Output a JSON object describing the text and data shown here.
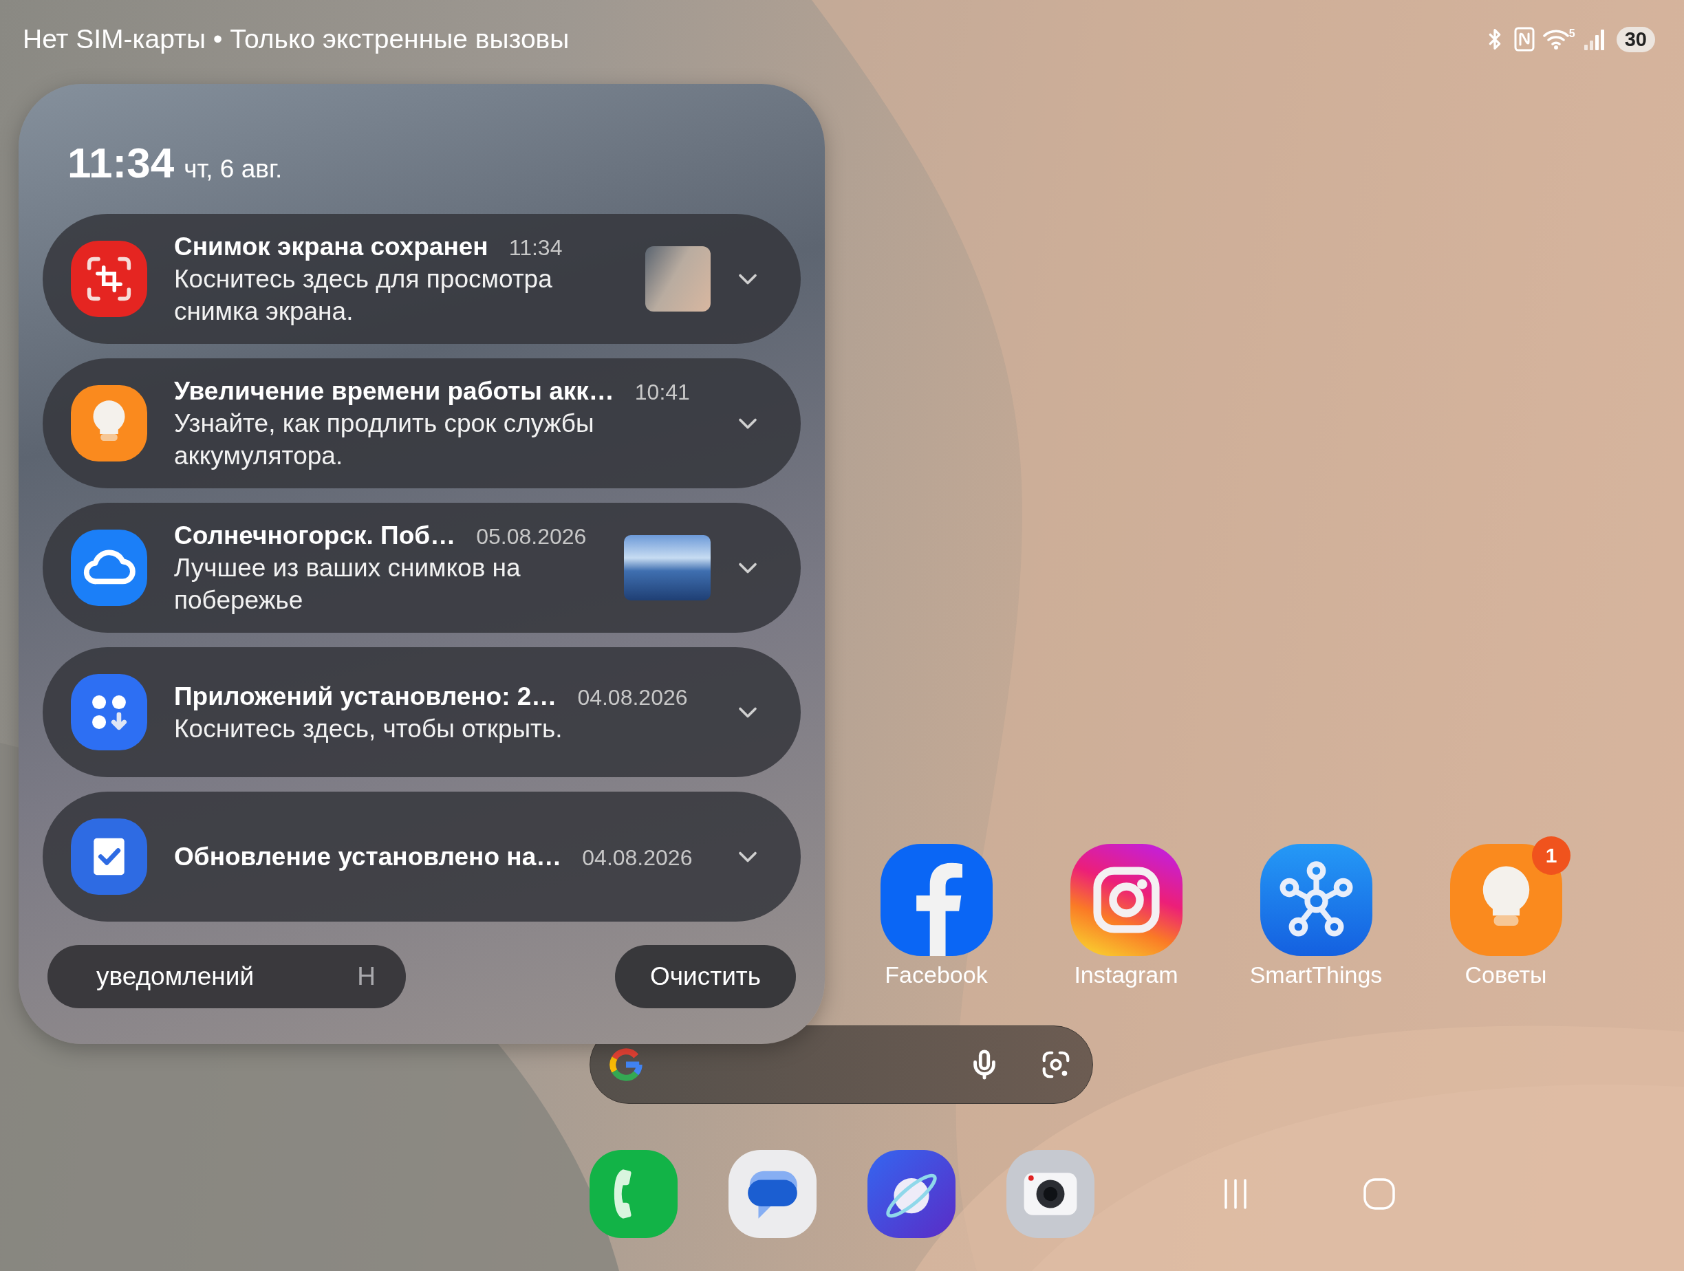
{
  "status_bar": {
    "message": "Нет SIM-карты • Только экстренные вызовы",
    "wifi_band": "5",
    "battery": "30"
  },
  "notification_panel": {
    "time": "11:34",
    "date": "чт, 6 авг.",
    "notifications": [
      {
        "kind": "screenshot",
        "title": "Снимок экрана сохранен",
        "time": "11:34",
        "body": "Коснитесь здесь для просмотра снимка экрана.",
        "thumbnail": true,
        "expanded": false
      },
      {
        "kind": "tips",
        "title": "Увеличение времени работы акк…",
        "time": "10:41",
        "body": "Узнайте, как продлить срок службы аккумулятора.",
        "thumbnail": false,
        "expanded": false
      },
      {
        "kind": "cloud",
        "title": "Солнечногорск. Поб…",
        "time": "05.08.2026",
        "body": "Лучшее из ваших снимков на побережье",
        "thumbnail": true,
        "expanded": false
      },
      {
        "kind": "apps",
        "title": "Приложений установлено: 2…",
        "time": "04.08.2026",
        "body": "Коснитесь здесь, чтобы открыть.",
        "thumbnail": false,
        "expanded": false
      },
      {
        "kind": "update",
        "title": "Обновление установлено на…",
        "time": "04.08.2026",
        "thumbnail": false,
        "expanded": false
      }
    ],
    "settings_button": [
      "уведомлений",
      "Н"
    ],
    "clear_button": "Очистить"
  },
  "home_apps": [
    {
      "kind": "facebook",
      "label": "Facebook"
    },
    {
      "kind": "instagram",
      "label": "Instagram"
    },
    {
      "kind": "smartthings",
      "label": "SmartThings"
    },
    {
      "kind": "tips",
      "label": "Советы",
      "badge": "1"
    }
  ]
}
